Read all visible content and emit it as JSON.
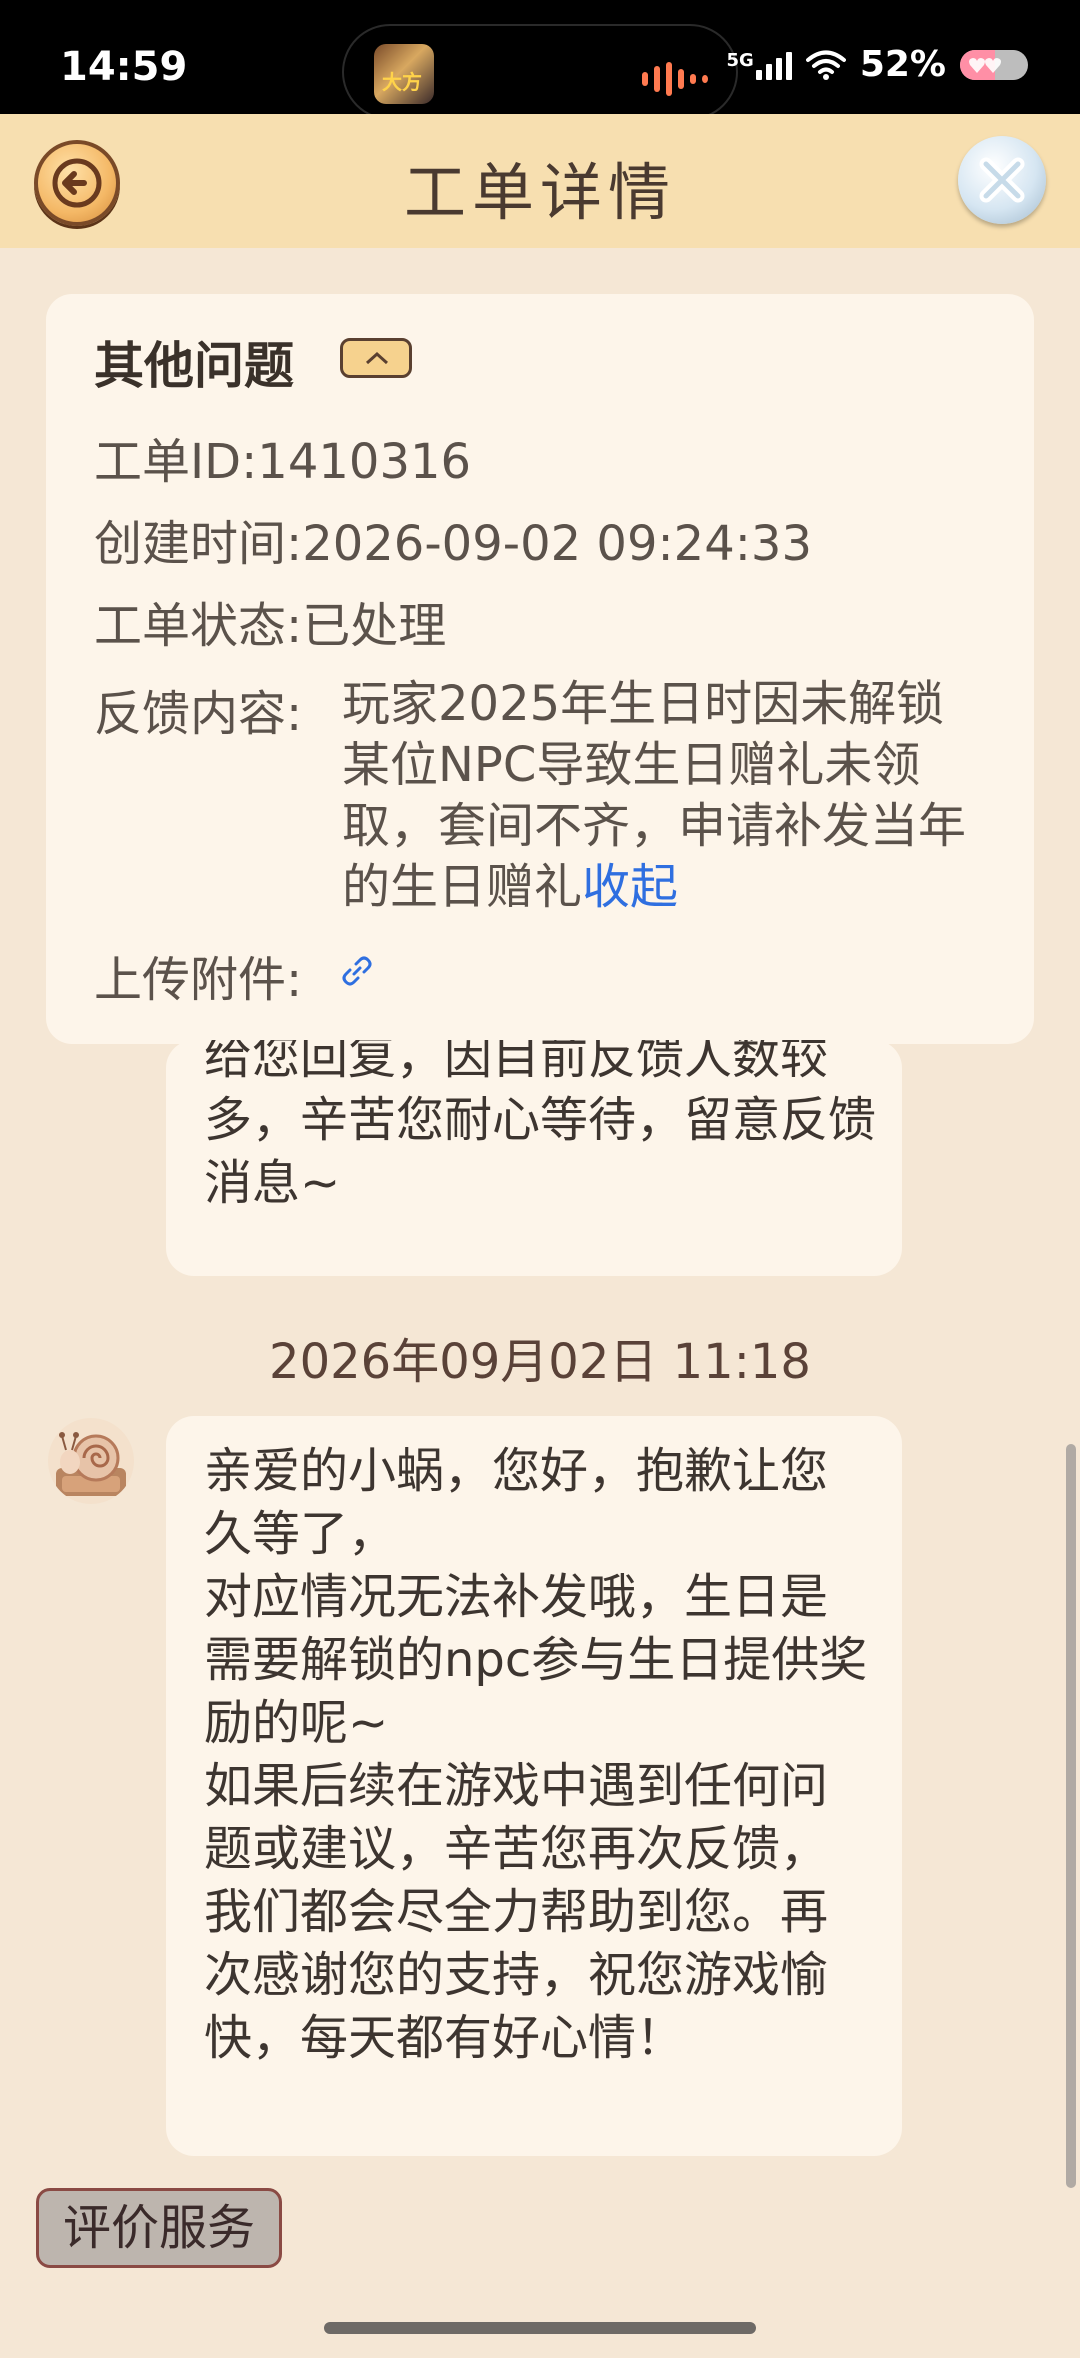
{
  "status_bar": {
    "time": "14:59",
    "network": "5G",
    "battery_text": "52%",
    "battery_level": 0.52,
    "island_app_label": "大方"
  },
  "header": {
    "title": "工单详情",
    "back_icon": "back-arrow-icon",
    "close_icon": "close-icon"
  },
  "ticket": {
    "type": "其他问题",
    "id_label": "工单ID: ",
    "id_value": "1410316",
    "created_label": "创建时间: ",
    "created_value": "2026-09-02 09:24:33",
    "status_label": "工单状态: ",
    "status_value": "已处理",
    "feedback_label": "反馈内容: ",
    "feedback_value": "玩家2025年生日时因未解锁某位NPC导致生日赠礼未领取，套间不齐，申请补发当年的生日赠礼",
    "collapse_link": "收起",
    "attachment_label": "上传附件: "
  },
  "chat": {
    "previous_message": "给您回复，因目前反馈人数较多，辛苦您耐心等待，留意反馈消息~",
    "timestamp": "2026年09月02日 11:18",
    "reply_message": "亲爱的小蜗，您好，抱歉让您久等了，\n对应情况无法补发哦，生日是需要解锁的npc参与生日提供奖励的呢~\n如果后续在游戏中遇到任何问题或建议，辛苦您再次反馈，我们都会尽全力帮助到您。再次感谢您的支持，祝您游戏愉快，每天都有好心情！"
  },
  "footer": {
    "rate_button": "评价服务"
  },
  "colors": {
    "background": "#f5e7d5",
    "header_bg": "#f7dfb0",
    "card_bg": "#fdf5ea",
    "link": "#2f6fe0"
  }
}
